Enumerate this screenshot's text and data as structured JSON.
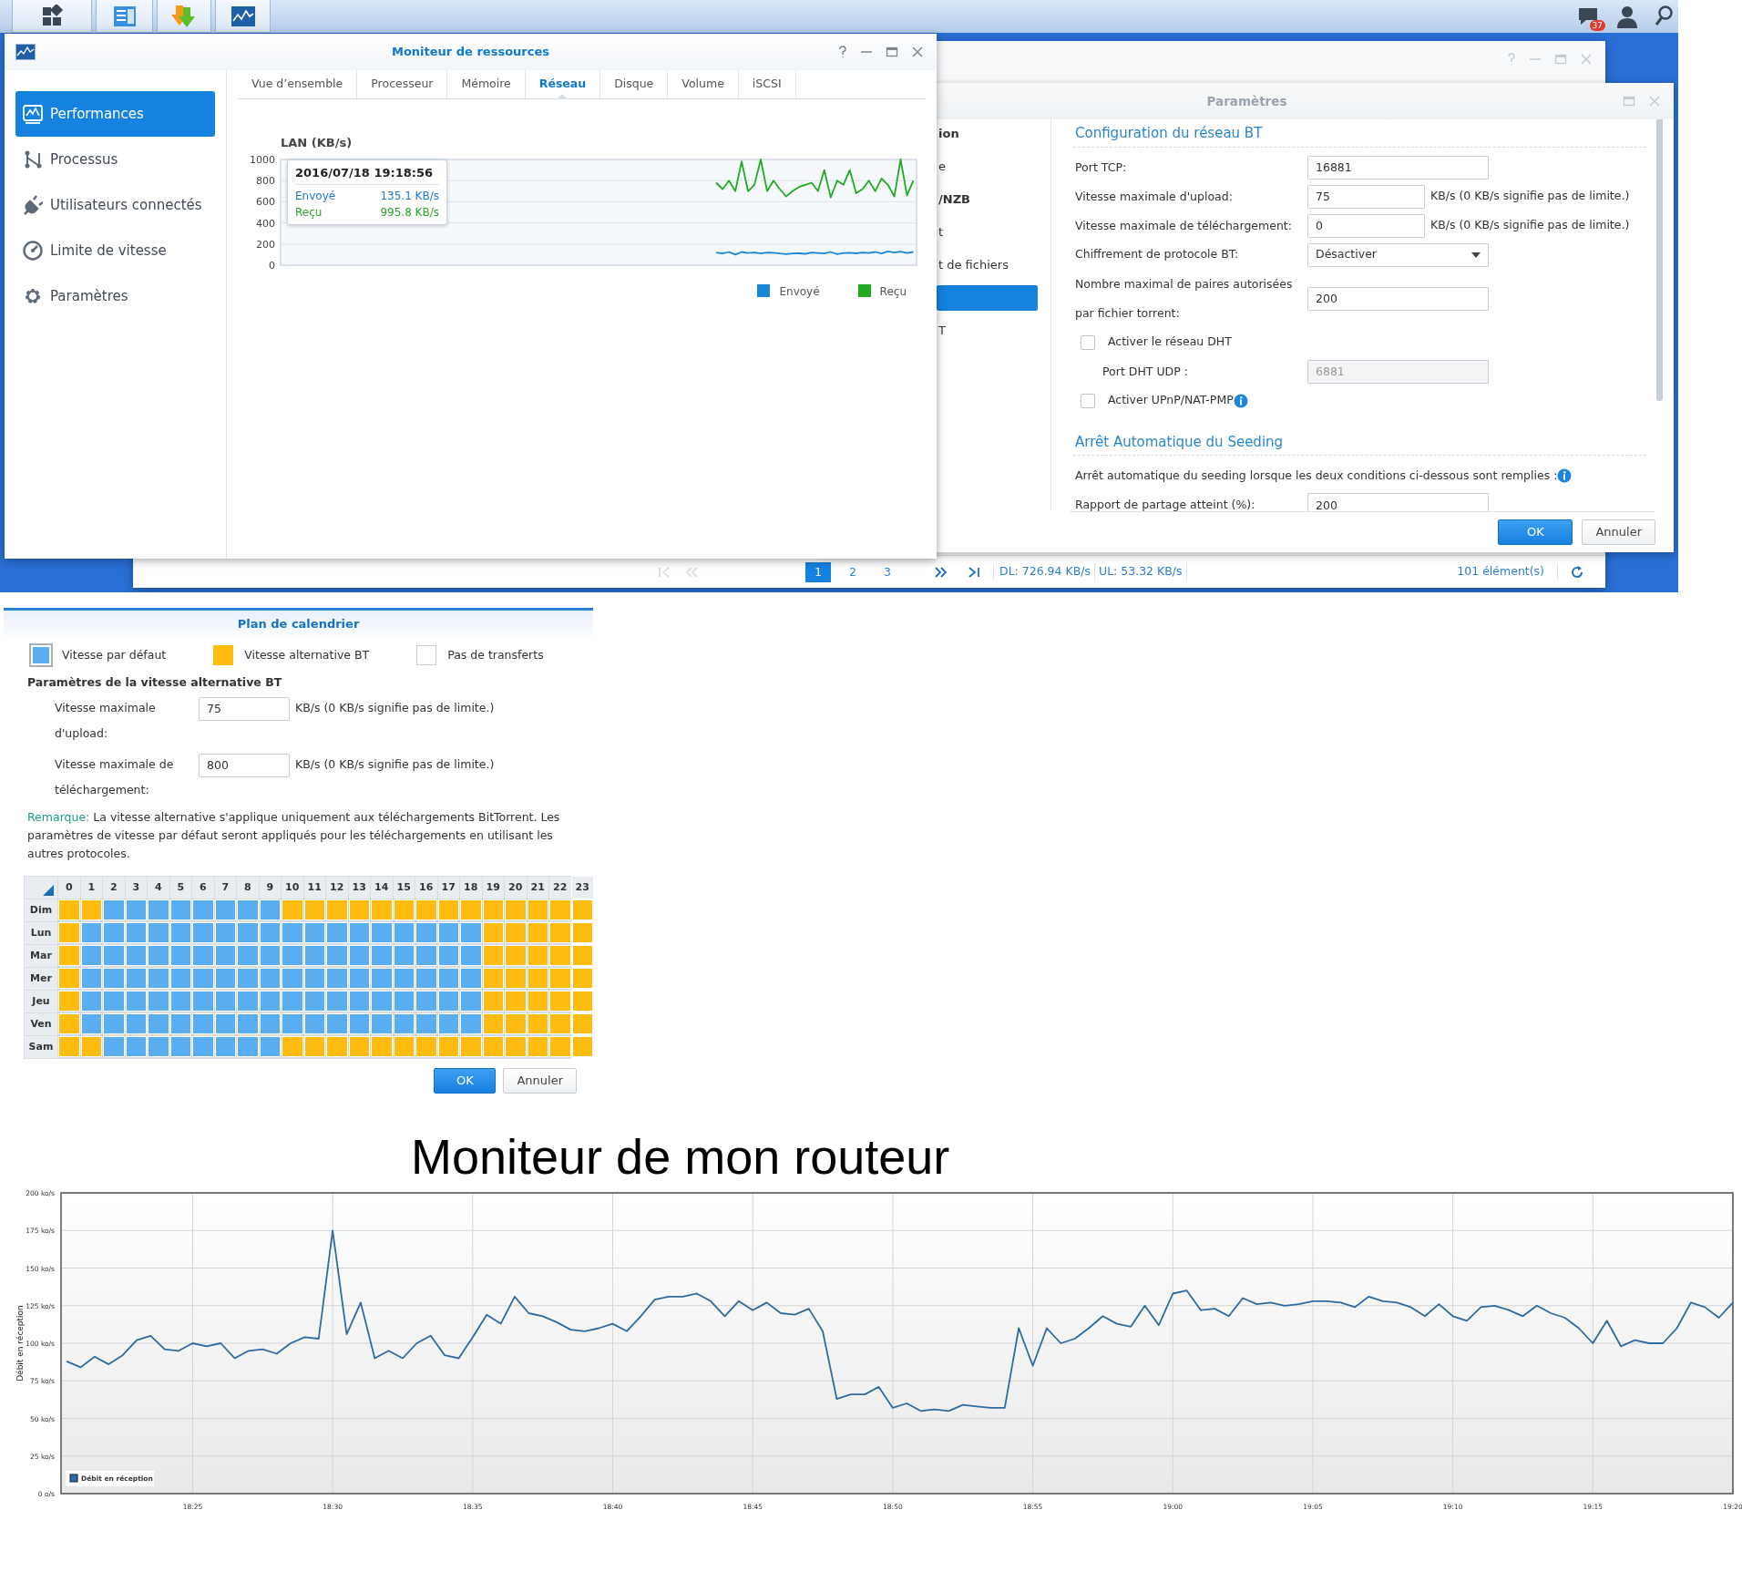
{
  "taskbar": {
    "notification_badge": "37"
  },
  "resource_monitor": {
    "title": "Moniteur de ressources",
    "sidebar": [
      {
        "label": "Performances",
        "selected": true
      },
      {
        "label": "Processus",
        "selected": false
      },
      {
        "label": "Utilisateurs connectés",
        "selected": false
      },
      {
        "label": "Limite de vitesse",
        "selected": false
      },
      {
        "label": "Paramètres",
        "selected": false
      }
    ],
    "tabs": [
      {
        "label": "Vue d’ensemble",
        "selected": false
      },
      {
        "label": "Processeur",
        "selected": false
      },
      {
        "label": "Mémoire",
        "selected": false
      },
      {
        "label": "Réseau",
        "selected": true
      },
      {
        "label": "Disque",
        "selected": false
      },
      {
        "label": "Volume",
        "selected": false
      },
      {
        "label": "iSCSI",
        "selected": false
      }
    ],
    "chart_data": {
      "type": "line",
      "title": "LAN (KB/s)",
      "categories": [
        null,
        null,
        null,
        null,
        null,
        null,
        null,
        null,
        null,
        null,
        null,
        null,
        null,
        null,
        null,
        null,
        null,
        null,
        null,
        null,
        null,
        null,
        null,
        null,
        null,
        null,
        null,
        null,
        null,
        null,
        null,
        null,
        null,
        null,
        null,
        null,
        null,
        null,
        null,
        null,
        null,
        null,
        null,
        null,
        null,
        null,
        null,
        null,
        null,
        null,
        null,
        null,
        null,
        null,
        null,
        null,
        null,
        null,
        null,
        null,
        null,
        null,
        null,
        null,
        null,
        null,
        null,
        null,
        null,
        null,
        null,
        null,
        null,
        null,
        null,
        null,
        null,
        null,
        null,
        null,
        null,
        null,
        null,
        null,
        null,
        null,
        null,
        null,
        null,
        null,
        null,
        null,
        null,
        null,
        null,
        null,
        null,
        null,
        null,
        null
      ],
      "series": [
        {
          "name": "Envoyé",
          "color": "#1a85d6",
          "values": [
            null,
            null,
            null,
            null,
            null,
            null,
            null,
            null,
            null,
            null,
            null,
            null,
            null,
            null,
            null,
            null,
            null,
            null,
            null,
            null,
            null,
            null,
            null,
            null,
            null,
            null,
            null,
            null,
            null,
            null,
            null,
            null,
            null,
            null,
            null,
            null,
            null,
            null,
            null,
            null,
            null,
            null,
            null,
            null,
            null,
            null,
            null,
            null,
            null,
            null,
            null,
            null,
            null,
            null,
            null,
            null,
            null,
            null,
            null,
            null,
            null,
            null,
            null,
            null,
            null,
            null,
            null,
            null,
            120,
            110,
            125,
            100,
            125,
            115,
            120,
            110,
            120,
            118,
            110,
            105,
            110,
            112,
            108,
            120,
            115,
            110,
            125,
            105,
            115,
            118,
            112,
            120,
            115,
            125,
            110,
            130,
            120,
            128,
            115,
            125
          ]
        },
        {
          "name": "Reçu",
          "color": "#22aa22",
          "values": [
            null,
            null,
            null,
            null,
            null,
            null,
            null,
            null,
            null,
            null,
            null,
            null,
            null,
            null,
            null,
            null,
            null,
            null,
            null,
            null,
            null,
            null,
            null,
            null,
            null,
            null,
            null,
            null,
            null,
            null,
            null,
            null,
            null,
            null,
            null,
            null,
            null,
            null,
            null,
            null,
            null,
            null,
            null,
            null,
            null,
            null,
            null,
            null,
            null,
            null,
            null,
            null,
            null,
            null,
            null,
            null,
            null,
            null,
            null,
            null,
            null,
            null,
            null,
            null,
            null,
            null,
            null,
            null,
            780,
            720,
            800,
            700,
            980,
            700,
            760,
            1000,
            700,
            800,
            720,
            650,
            700,
            740,
            760,
            780,
            700,
            900,
            640,
            800,
            760,
            900,
            680,
            720,
            800,
            700,
            820,
            760,
            650,
            1000,
            660,
            800
          ]
        }
      ],
      "ylim": [
        0,
        1000
      ],
      "yticks": [
        0,
        200,
        400,
        600,
        800,
        1000
      ],
      "grid": true
    },
    "tooltip": {
      "time": "2016/07/18 19:18:56",
      "rows": [
        {
          "label": "Envoyé",
          "value": "135.1 KB/s",
          "color": "#1b7ad1"
        },
        {
          "label": "Reçu",
          "value": "995.8 KB/s",
          "color": "#2aa52a"
        }
      ]
    }
  },
  "download_window": {
    "pager": [
      {
        "kind": "first",
        "disabled": true
      },
      {
        "kind": "prev",
        "disabled": true
      }
    ],
    "pages": [
      {
        "label": "1",
        "selected": true
      },
      {
        "label": "2",
        "selected": false
      },
      {
        "label": "3",
        "selected": false
      }
    ],
    "pager_end": [
      {
        "kind": "next",
        "disabled": false
      },
      {
        "kind": "last",
        "disabled": false
      }
    ],
    "dl": "DL: 726.94 KB/s",
    "ul": "UL: 53.32 KB/s",
    "count": "101 élément(s)"
  },
  "settings_window": {
    "title": "Paramètres",
    "sidebar": [
      {
        "label": "ion",
        "kind": "header",
        "selected": false
      },
      {
        "label": "e",
        "kind": "item",
        "selected": false
      },
      {
        "label": "/NZB",
        "kind": "header",
        "selected": false
      },
      {
        "label": "t",
        "kind": "item",
        "selected": false
      },
      {
        "label": "t de fichiers",
        "kind": "item",
        "selected": false
      },
      {
        "kind": "item",
        "selected": true
      },
      {
        "label": "T",
        "kind": "item",
        "selected": false
      }
    ],
    "sections": [
      {
        "title": "Configuration du réseau BT",
        "rows": [
          {
            "kind": "input",
            "label": "Port TCP:",
            "value": "16881"
          },
          {
            "kind": "input_unit",
            "label": "Vitesse maximale d'upload:",
            "value": "75",
            "unit": "KB/s (0 KB/s signifie pas de limite.)"
          },
          {
            "kind": "input_unit",
            "label": "Vitesse maximale de téléchargement:",
            "value": "0",
            "unit": "KB/s (0 KB/s signifie pas de limite.)"
          },
          {
            "kind": "select",
            "label": "Chiffrement de protocole BT:",
            "value": "Désactiver"
          },
          {
            "kind": "input",
            "label": "Nombre maximal de paires autorisées par fichier torrent:",
            "value": "200"
          },
          {
            "kind": "checkbox",
            "label": "Activer le réseau DHT",
            "checked": false,
            "info": false
          },
          {
            "kind": "sub_input",
            "label": "Port DHT UDP :",
            "value": "6881"
          },
          {
            "kind": "checkbox",
            "label": "Activer UPnP/NAT-PMP",
            "checked": false,
            "info": true
          }
        ]
      },
      {
        "title": "Arrêt Automatique du Seeding",
        "rows": [
          {
            "kind": "note",
            "label": "Arrêt automatique du seeding lorsque les deux conditions ci-dessous sont remplies :",
            "info": true
          },
          {
            "kind": "input",
            "label": "Rapport de partage atteint (%):",
            "value": "200"
          }
        ]
      }
    ],
    "buttons": [
      {
        "label": "OK",
        "kind": "primary"
      },
      {
        "label": "Annuler",
        "kind": "secondary"
      }
    ]
  },
  "calendar": {
    "title": "Plan de calendrier",
    "legend": [
      {
        "label": "Vitesse par défaut",
        "kind": "default",
        "selected": true
      },
      {
        "label": "Vitesse alternative BT",
        "kind": "alt",
        "selected": false
      },
      {
        "label": "Pas de transferts",
        "kind": "none",
        "selected": false
      }
    ],
    "section_title": "Paramètres de la vitesse alternative BT",
    "fields": [
      {
        "label": "Vitesse maximale d'upload:",
        "value": "75",
        "unit": "KB/s (0 KB/s signifie pas de limite.)"
      },
      {
        "label": "Vitesse maximale de téléchargement:",
        "value": "800",
        "unit": "KB/s (0 KB/s signifie pas de limite.)"
      }
    ],
    "note_label": "Remarque:",
    "note": "La vitesse alternative s'applique uniquement aux téléchargements BitTorrent. Les paramètres de vitesse par défaut seront appliqués pour les téléchargements en utilisant les autres protocoles.",
    "hours": [
      "0",
      "1",
      "2",
      "3",
      "4",
      "5",
      "6",
      "7",
      "8",
      "9",
      "10",
      "11",
      "12",
      "13",
      "14",
      "15",
      "16",
      "17",
      "18",
      "19",
      "20",
      "21",
      "22",
      "23"
    ],
    "days": [
      {
        "label": "Dim",
        "cells": [
          {
            "kind": "alt"
          },
          {
            "kind": "alt"
          },
          {
            "kind": "default"
          },
          {
            "kind": "default"
          },
          {
            "kind": "default"
          },
          {
            "kind": "default"
          },
          {
            "kind": "default"
          },
          {
            "kind": "default"
          },
          {
            "kind": "default"
          },
          {
            "kind": "default"
          },
          {
            "kind": "alt"
          },
          {
            "kind": "alt"
          },
          {
            "kind": "alt"
          },
          {
            "kind": "alt"
          },
          {
            "kind": "alt"
          },
          {
            "kind": "alt"
          },
          {
            "kind": "alt"
          },
          {
            "kind": "alt"
          },
          {
            "kind": "alt"
          },
          {
            "kind": "alt"
          },
          {
            "kind": "alt"
          },
          {
            "kind": "alt"
          },
          {
            "kind": "alt"
          },
          {
            "kind": "alt"
          }
        ]
      },
      {
        "label": "Lun",
        "cells": [
          {
            "kind": "alt"
          },
          {
            "kind": "default"
          },
          {
            "kind": "default"
          },
          {
            "kind": "default"
          },
          {
            "kind": "default"
          },
          {
            "kind": "default"
          },
          {
            "kind": "default"
          },
          {
            "kind": "default"
          },
          {
            "kind": "default"
          },
          {
            "kind": "default"
          },
          {
            "kind": "default"
          },
          {
            "kind": "default"
          },
          {
            "kind": "default"
          },
          {
            "kind": "default"
          },
          {
            "kind": "default"
          },
          {
            "kind": "default"
          },
          {
            "kind": "default"
          },
          {
            "kind": "default"
          },
          {
            "kind": "default"
          },
          {
            "kind": "alt"
          },
          {
            "kind": "alt"
          },
          {
            "kind": "alt"
          },
          {
            "kind": "alt"
          },
          {
            "kind": "alt"
          }
        ]
      },
      {
        "label": "Mar",
        "cells": [
          {
            "kind": "alt"
          },
          {
            "kind": "default"
          },
          {
            "kind": "default"
          },
          {
            "kind": "default"
          },
          {
            "kind": "default"
          },
          {
            "kind": "default"
          },
          {
            "kind": "default"
          },
          {
            "kind": "default"
          },
          {
            "kind": "default"
          },
          {
            "kind": "default"
          },
          {
            "kind": "default"
          },
          {
            "kind": "default"
          },
          {
            "kind": "default"
          },
          {
            "kind": "default"
          },
          {
            "kind": "default"
          },
          {
            "kind": "default"
          },
          {
            "kind": "default"
          },
          {
            "kind": "default"
          },
          {
            "kind": "default"
          },
          {
            "kind": "alt"
          },
          {
            "kind": "alt"
          },
          {
            "kind": "alt"
          },
          {
            "kind": "alt"
          },
          {
            "kind": "alt"
          }
        ]
      },
      {
        "label": "Mer",
        "cells": [
          {
            "kind": "alt"
          },
          {
            "kind": "default"
          },
          {
            "kind": "default"
          },
          {
            "kind": "default"
          },
          {
            "kind": "default"
          },
          {
            "kind": "default"
          },
          {
            "kind": "default"
          },
          {
            "kind": "default"
          },
          {
            "kind": "default"
          },
          {
            "kind": "default"
          },
          {
            "kind": "default"
          },
          {
            "kind": "default"
          },
          {
            "kind": "default"
          },
          {
            "kind": "default"
          },
          {
            "kind": "default"
          },
          {
            "kind": "default"
          },
          {
            "kind": "default"
          },
          {
            "kind": "default"
          },
          {
            "kind": "default"
          },
          {
            "kind": "alt"
          },
          {
            "kind": "alt"
          },
          {
            "kind": "alt"
          },
          {
            "kind": "alt"
          },
          {
            "kind": "alt"
          }
        ]
      },
      {
        "label": "Jeu",
        "cells": [
          {
            "kind": "alt"
          },
          {
            "kind": "default"
          },
          {
            "kind": "default"
          },
          {
            "kind": "default"
          },
          {
            "kind": "default"
          },
          {
            "kind": "default"
          },
          {
            "kind": "default"
          },
          {
            "kind": "default"
          },
          {
            "kind": "default"
          },
          {
            "kind": "default"
          },
          {
            "kind": "default"
          },
          {
            "kind": "default"
          },
          {
            "kind": "default"
          },
          {
            "kind": "default"
          },
          {
            "kind": "default"
          },
          {
            "kind": "default"
          },
          {
            "kind": "default"
          },
          {
            "kind": "default"
          },
          {
            "kind": "default"
          },
          {
            "kind": "alt"
          },
          {
            "kind": "alt"
          },
          {
            "kind": "alt"
          },
          {
            "kind": "alt"
          },
          {
            "kind": "alt"
          }
        ]
      },
      {
        "label": "Ven",
        "cells": [
          {
            "kind": "alt"
          },
          {
            "kind": "default"
          },
          {
            "kind": "default"
          },
          {
            "kind": "default"
          },
          {
            "kind": "default"
          },
          {
            "kind": "default"
          },
          {
            "kind": "default"
          },
          {
            "kind": "default"
          },
          {
            "kind": "default"
          },
          {
            "kind": "default"
          },
          {
            "kind": "default"
          },
          {
            "kind": "default"
          },
          {
            "kind": "default"
          },
          {
            "kind": "default"
          },
          {
            "kind": "default"
          },
          {
            "kind": "default"
          },
          {
            "kind": "default"
          },
          {
            "kind": "default"
          },
          {
            "kind": "default"
          },
          {
            "kind": "alt"
          },
          {
            "kind": "alt"
          },
          {
            "kind": "alt"
          },
          {
            "kind": "alt"
          },
          {
            "kind": "alt"
          }
        ]
      },
      {
        "label": "Sam",
        "cells": [
          {
            "kind": "alt"
          },
          {
            "kind": "alt"
          },
          {
            "kind": "default"
          },
          {
            "kind": "default"
          },
          {
            "kind": "default"
          },
          {
            "kind": "default"
          },
          {
            "kind": "default"
          },
          {
            "kind": "default"
          },
          {
            "kind": "default"
          },
          {
            "kind": "default"
          },
          {
            "kind": "alt"
          },
          {
            "kind": "alt"
          },
          {
            "kind": "alt"
          },
          {
            "kind": "alt"
          },
          {
            "kind": "alt"
          },
          {
            "kind": "alt"
          },
          {
            "kind": "alt"
          },
          {
            "kind": "alt"
          },
          {
            "kind": "alt"
          },
          {
            "kind": "alt"
          },
          {
            "kind": "alt"
          },
          {
            "kind": "alt"
          },
          {
            "kind": "alt"
          },
          {
            "kind": "alt"
          }
        ]
      }
    ],
    "buttons": [
      {
        "label": "OK",
        "kind": "primary"
      },
      {
        "label": "Annuler",
        "kind": "secondary"
      }
    ]
  },
  "router": {
    "title": "Moniteur de mon routeur",
    "chart_data": {
      "type": "line",
      "ylabel": "Débit en réception",
      "categories": [
        null,
        null,
        null,
        null,
        null,
        null,
        null,
        null,
        null,
        "18:25",
        null,
        null,
        null,
        null,
        null,
        null,
        null,
        null,
        null,
        "18:30",
        null,
        null,
        null,
        null,
        null,
        null,
        null,
        null,
        null,
        "18:35",
        null,
        null,
        null,
        null,
        null,
        null,
        null,
        null,
        null,
        "18:40",
        null,
        null,
        null,
        null,
        null,
        null,
        null,
        null,
        null,
        "18:45",
        null,
        null,
        null,
        null,
        null,
        null,
        null,
        null,
        null,
        "18:50",
        null,
        null,
        null,
        null,
        null,
        null,
        null,
        null,
        null,
        "18:55",
        null,
        null,
        null,
        null,
        null,
        null,
        null,
        null,
        null,
        "19:00",
        null,
        null,
        null,
        null,
        null,
        null,
        null,
        null,
        null,
        "19:05",
        null,
        null,
        null,
        null,
        null,
        null,
        null,
        null,
        null,
        "19:10",
        null,
        null,
        null,
        null,
        null,
        null,
        null,
        null,
        null,
        "19:15",
        null,
        null,
        null,
        null,
        null,
        null,
        null,
        null,
        null,
        "19:20"
      ],
      "series": [
        {
          "name": "Débit en réception",
          "color": "#2f6aa0",
          "values": [
            88,
            84,
            91,
            86,
            92,
            102,
            105,
            96,
            95,
            100,
            98,
            100,
            90,
            95,
            96,
            93,
            100,
            104,
            103,
            175,
            106,
            127,
            90,
            95,
            90,
            100,
            105,
            92,
            90,
            104,
            119,
            113,
            131,
            120,
            118,
            114,
            109,
            108,
            110,
            113,
            108,
            118,
            129,
            131,
            131,
            133,
            128,
            118,
            128,
            122,
            127,
            120,
            119,
            123,
            108,
            63,
            66,
            66,
            71,
            57,
            60,
            55,
            56,
            55,
            59,
            58,
            57,
            57,
            110,
            85,
            110,
            100,
            103,
            110,
            118,
            113,
            111,
            125,
            112,
            133,
            135,
            122,
            123,
            118,
            130,
            126,
            127,
            125,
            126,
            128,
            128,
            127,
            124,
            131,
            128,
            127,
            124,
            118,
            126,
            118,
            115,
            124,
            125,
            122,
            118,
            125,
            120,
            117,
            110,
            100,
            115,
            98,
            102,
            100,
            100,
            110,
            127,
            124,
            117,
            127
          ]
        }
      ],
      "ylim": [
        0,
        200
      ],
      "grid": true,
      "yticks": [
        {
          "value": 0,
          "label": "0 o/s"
        },
        {
          "value": 25,
          "label": "25 ko/s"
        },
        {
          "value": 50,
          "label": "50 ko/s"
        },
        {
          "value": 75,
          "label": "75 ko/s"
        },
        {
          "value": 100,
          "label": "100 ko/s"
        },
        {
          "value": 125,
          "label": "125 ko/s"
        },
        {
          "value": 150,
          "label": "150 ko/s"
        },
        {
          "value": 175,
          "label": "175 ko/s"
        },
        {
          "value": 200,
          "label": "200 ko/s"
        }
      ]
    }
  }
}
